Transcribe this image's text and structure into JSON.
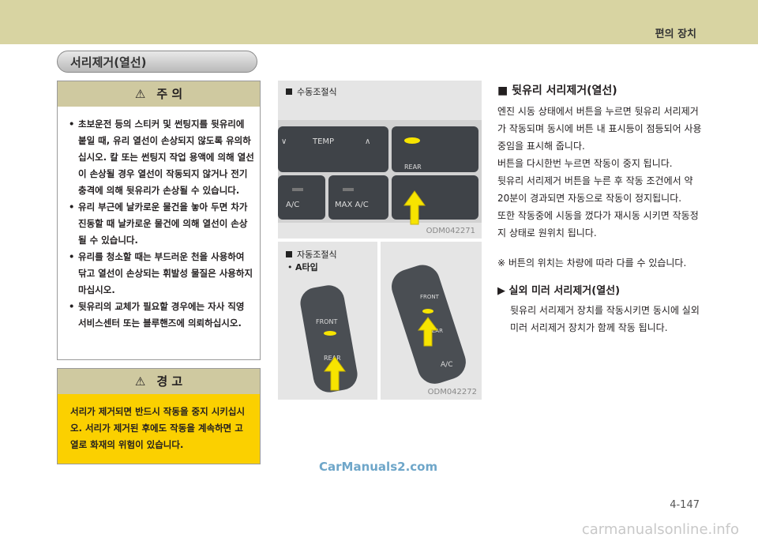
{
  "header": {
    "section": "편의 장치"
  },
  "section_title": "서리제거(열선)",
  "caution": {
    "label": "주     의",
    "items": [
      "초보운전 등의 스티커 및 썬팅지를 뒷유리에 붙일 때, 유리 열선이 손상되지 않도록 유의하십시오. 칼 또는 썬팅지 작업 용액에 의해 열선이 손상될 경우 열선이 작동되지 않거나 전기 충격에 의해 뒷유리가 손상될 수 있습니다.",
      "유리 부근에 날카로운 물건을 놓아 두면 차가 진동할 때 날카로운 물건에 의해 열선이 손상될 수 있습니다.",
      "유리를 청소할 때는 부드러운 천을 사용하여 닦고 열선이 손상되는 휘발성 물질은 사용하지 마십시오.",
      "뒷유리의 교체가 필요할 경우에는 자사 직영 서비스센터 또는 블루핸즈에 의뢰하십시오."
    ]
  },
  "warning": {
    "label": "경     고",
    "text": "서리가 제거되면 반드시 작동을 중지 시키십시오. 서리가 제거된 후에도 작동을 계속하면 고열로 화재의 위험이 있습니다."
  },
  "figure1": {
    "label": "수동조절식",
    "temp": "TEMP",
    "ac": "A/C",
    "max_ac": "MAX A/C",
    "rear": "REAR",
    "code": "ODM042271"
  },
  "figure2": {
    "label": "자동조절식",
    "sub": "A타입",
    "front": "FRONT",
    "rear": "REAR",
    "code": "ODM042272"
  },
  "figure3": {
    "front": "FRONT",
    "rear": "REAR",
    "ac": "A/C"
  },
  "right": {
    "title": "뒷유리 서리제거(열선)",
    "paragraphs": [
      "엔진 시동 상태에서 버튼을 누르면 뒷유리 서리제거가 작동되며 동시에 버튼 내 표시등이 점등되어 사용중임을 표시해 줍니다.",
      "버튼을 다시한번 누르면 작동이 중지 됩니다.",
      "뒷유리 서리제거 버튼을 누른 후 작동 조건에서 약 20분이 경과되면 자동으로 작동이 정지됩니다.",
      "또한 작동중에 시동을 껐다가 재시동 시키면 작동정지 상태로 원위치 됩니다."
    ],
    "note": "※ 버튼의 위치는 차량에 따라 다를 수 있습니다.",
    "sub_title": "실외 미러 서리제거(열선)",
    "sub_text": "뒷유리 서리제거 장치를 작동시키면 동시에 실외 미러 서리제거 장치가 함께 작동 됩니다."
  },
  "page_number": "4-147",
  "watermarks": [
    "CarManuals2.com",
    "carmanualsonline.info"
  ]
}
